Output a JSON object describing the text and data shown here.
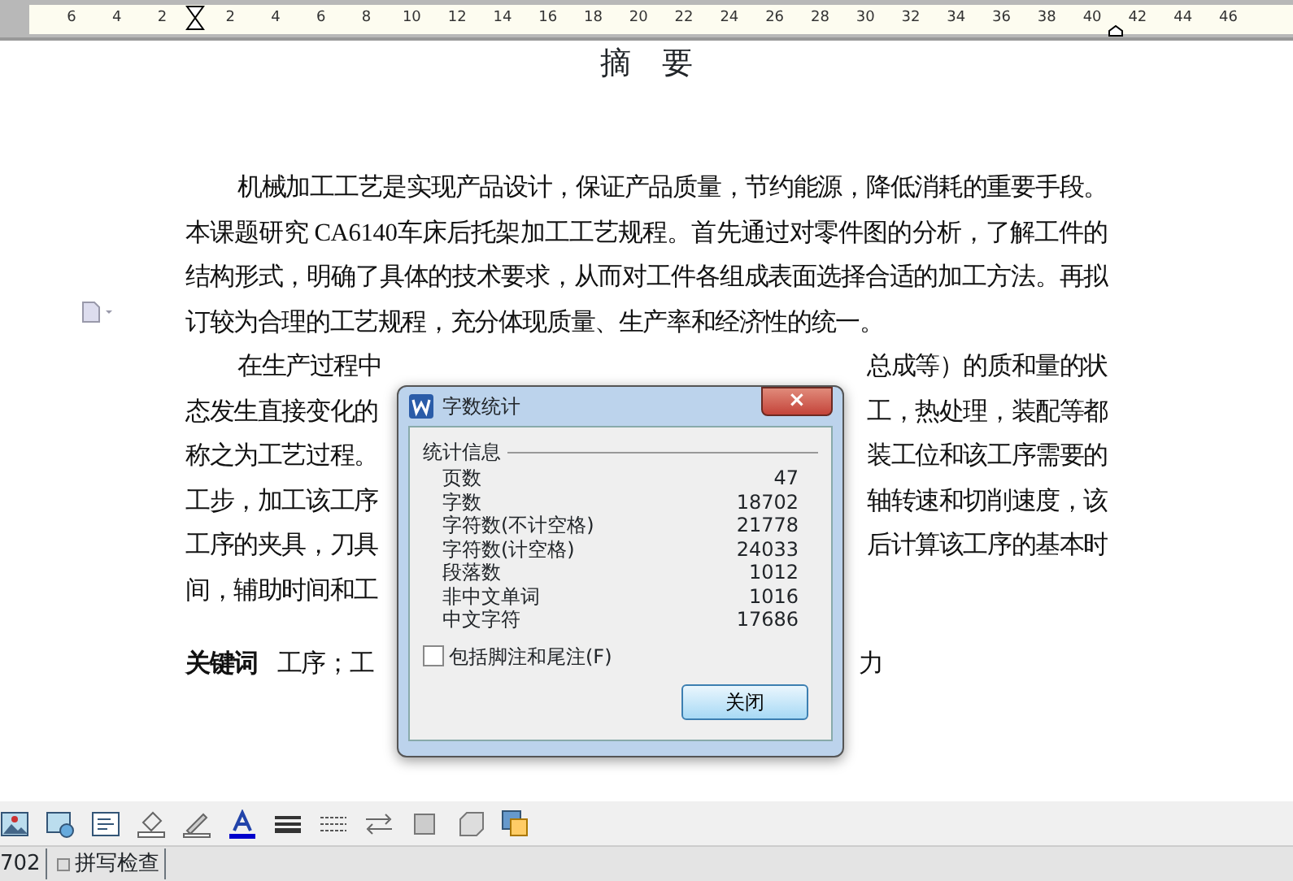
{
  "ruler": {
    "left_ticks": [
      "6",
      "4",
      "2"
    ],
    "right_ticks": [
      "2",
      "4",
      "6",
      "8",
      "10",
      "12",
      "14",
      "16",
      "18",
      "20",
      "22",
      "24",
      "26",
      "28",
      "30",
      "32",
      "34",
      "36",
      "38",
      "40",
      "42",
      "44",
      "46"
    ]
  },
  "document": {
    "title": "摘　要",
    "paragraph_1": "机械加工工艺是实现产品设计，保证产品质量，节约能源，降低消耗的重要手段。本课题研究 CA6140车床后托架加工工艺规程。首先通过对零件图的分析，了解工件的结构形式，明确了具体的技术要求，从而对工件各组成表面选择合适的加工方法。再拟订较为合理的工艺规程，充分体现质量、生产率和经济性的统一。",
    "paragraph_2_lines": [
      {
        "left": "在生产过程中",
        "right": "总成等）的质和量的状"
      },
      {
        "left": "态发生直接变化的",
        "right": "工，热处理，装配等都"
      },
      {
        "left": "称之为工艺过程。",
        "right": "装工位和该工序需要的"
      },
      {
        "left": "工步，加工该工序",
        "right": "轴转速和切削速度，该"
      },
      {
        "left": "工序的夹具，刀具",
        "right": "后计算该工序的基本时"
      },
      {
        "left": "间，辅助时间和工"
      }
    ],
    "keywords": {
      "label": "关键词",
      "left": "工序；工",
      "right": "力"
    }
  },
  "dialog": {
    "title": "字数统计",
    "close": "×",
    "group": "统计信息",
    "rows": [
      {
        "label": "页数",
        "value": "47"
      },
      {
        "label": "字数",
        "value": "18702"
      },
      {
        "label": "字符数(不计空格)",
        "value": "21778"
      },
      {
        "label": "字符数(计空格)",
        "value": "24033"
      },
      {
        "label": "段落数",
        "value": "1012"
      },
      {
        "label": "非中文单词",
        "value": "1016"
      },
      {
        "label": "中文字符",
        "value": "17686"
      }
    ],
    "checkbox": {
      "label": "包括脚注和尾注(F)",
      "checked": false
    },
    "button": "关闭"
  },
  "status_bar": {
    "word_count": "702",
    "spell_check": "拼写检查"
  }
}
